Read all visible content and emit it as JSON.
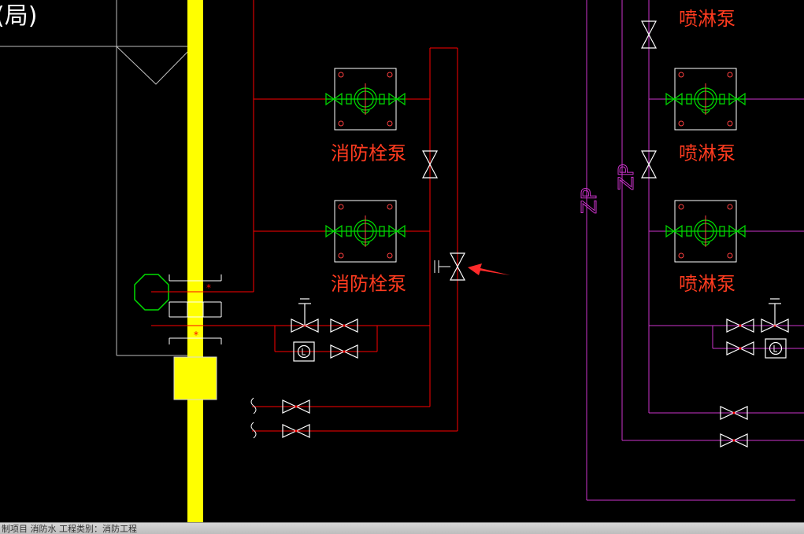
{
  "drawing": {
    "corner_text": "(局)",
    "pump_labels": {
      "hydrant_pump_1": "消防栓泵",
      "hydrant_pump_2": "消防栓泵",
      "sprinkler_pump_top": "喷淋泵",
      "sprinkler_pump_1": "喷淋泵",
      "sprinkler_pump_2": "喷淋泵"
    },
    "riser_labels": [
      "ZP",
      "ZP"
    ]
  },
  "status_bar": {
    "text": "制项目  消防水  工程类别：消防工程"
  },
  "colors": {
    "background": "#000000",
    "pipe_red": "#ff0000",
    "pipe_magenta": "#cc33cc",
    "wall_yellow": "#ffff00",
    "valve_white": "#ffffff",
    "pump_green": "#00e000",
    "arrow_red": "#ff2a2a",
    "label_red": "#ff3b1f",
    "octagon_green": "#00dd00"
  },
  "icons": [
    "gate-valve-icon",
    "pump-icon",
    "level-gauge-icon",
    "arrow-pointer-icon",
    "check-valve-icon"
  ]
}
